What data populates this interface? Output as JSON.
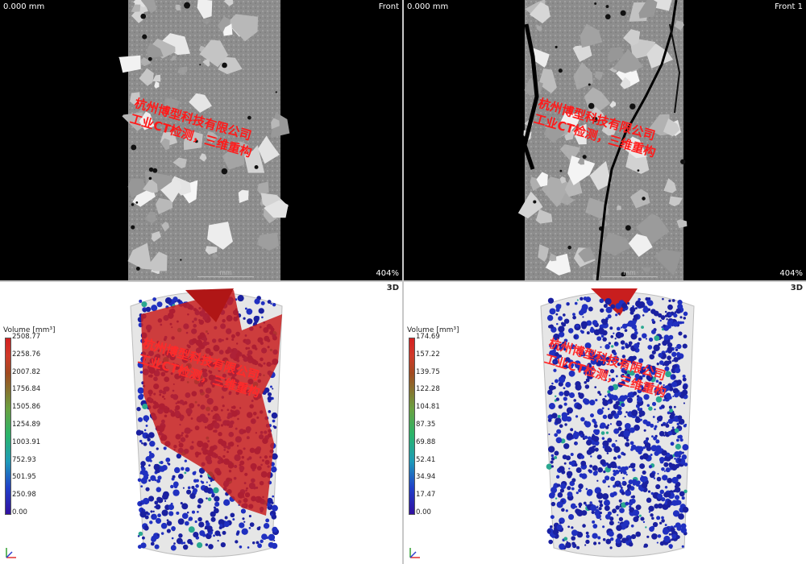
{
  "views": {
    "top_left": {
      "pos_label": "0.000 mm",
      "view_label": "Front",
      "zoom": "404%",
      "scale_label": "mm"
    },
    "top_right": {
      "pos_label": "0.000 mm",
      "view_label": "Front 1",
      "zoom": "404%",
      "scale_label": "mm"
    },
    "bottom_left": {
      "mode_label": "3D"
    },
    "bottom_right": {
      "mode_label": "3D"
    }
  },
  "watermark": {
    "line1": "杭州博型科技有限公司",
    "line2": "工业CT检测，三维重构",
    "color": "#ff1a1a"
  },
  "legend_left": {
    "title": "Volume [mm³]",
    "ticks": [
      "2508.77",
      "2258.76",
      "2007.82",
      "1756.84",
      "1505.86",
      "1254.89",
      "1003.91",
      "752.93",
      "501.95",
      "250.98",
      "0.00"
    ]
  },
  "legend_right": {
    "title": "Volume [mm³]",
    "ticks": [
      "174.69",
      "157.22",
      "139.75",
      "122.28",
      "104.81",
      "87.35",
      "69.88",
      "52.41",
      "34.94",
      "17.47",
      "0.00"
    ]
  }
}
